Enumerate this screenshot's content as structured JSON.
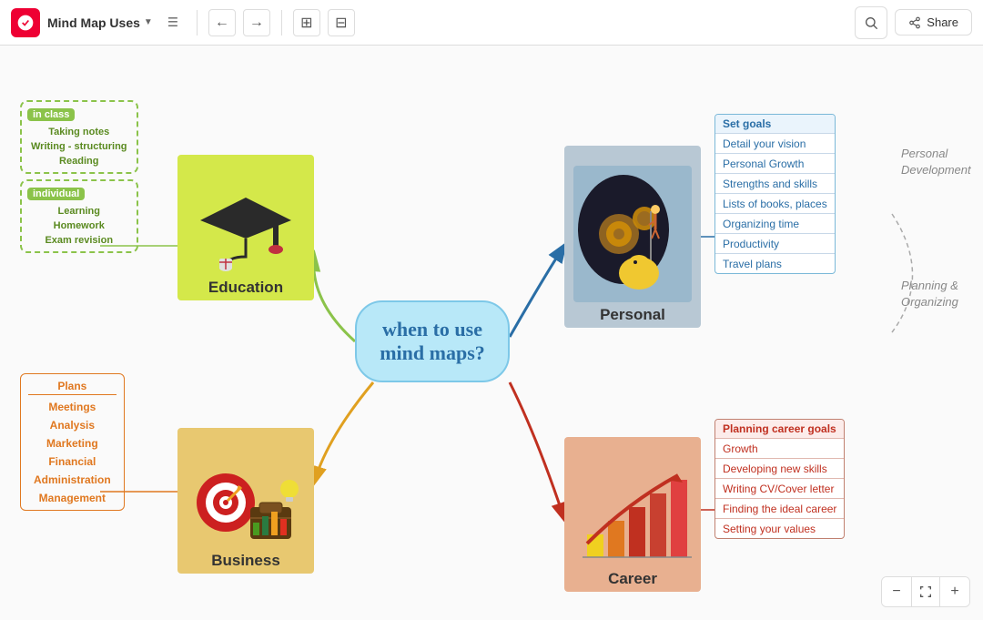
{
  "toolbar": {
    "logo_alt": "App Logo",
    "title": "Mind Map Uses",
    "menu_icon": "☰",
    "undo_icon": "↺",
    "redo_icon": "↻",
    "layout_icon": "⊞",
    "search_icon": "🔍",
    "share_label": "Share"
  },
  "center": {
    "text": "when to use\nmind maps?"
  },
  "education": {
    "label": "Education",
    "in_class_tag": "in class",
    "in_class_items": [
      "Taking notes",
      "Writing - structuring",
      "Reading"
    ],
    "individual_tag": "individual",
    "individual_items": [
      "Learning",
      "Homework",
      "Exam revision"
    ]
  },
  "personal": {
    "label": "Personal",
    "items": [
      "Set goals",
      "Detail your vision",
      "Personal Growth",
      "Strengths and skills",
      "Lists of books, places",
      "Organizing time",
      "Productivity",
      "Travel plans"
    ]
  },
  "business": {
    "label": "Business",
    "header": "Plans",
    "items": [
      "Meetings",
      "Analysis",
      "Marketing",
      "Financial",
      "Administration",
      "Management"
    ]
  },
  "career": {
    "label": "Career",
    "items": [
      "Planning career goals",
      "Growth",
      "Developing new skills",
      "Writing CV/Cover letter",
      "Finding the ideal career",
      "Setting  your values"
    ]
  },
  "side_labels": {
    "personal_development": "Personal\nDevelopment",
    "planning_organizing": "Planning &\nOrganizing"
  },
  "zoom": {
    "minus": "−",
    "fit": "⤢",
    "plus": "+"
  }
}
